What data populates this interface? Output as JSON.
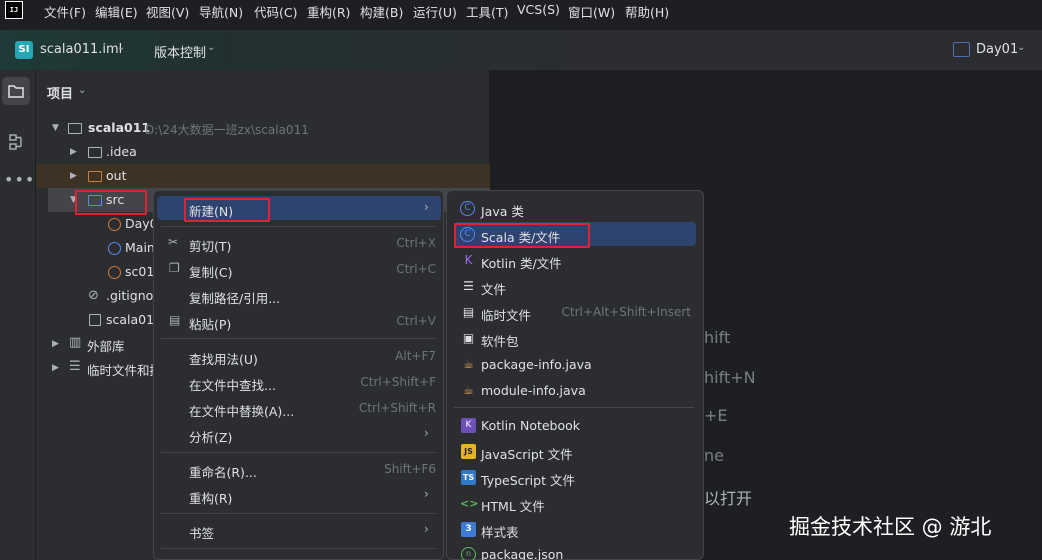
{
  "menubar": {
    "logo": "IJ",
    "items": [
      "文件(F)",
      "编辑(E)",
      "视图(V)",
      "导航(N)",
      "代码(C)",
      "重构(R)",
      "构建(B)",
      "运行(U)",
      "工具(T)",
      "VCS(S)",
      "窗口(W)",
      "帮助(H)"
    ]
  },
  "toolbar": {
    "project_badge": "SI",
    "project_name": "scala011.iml",
    "vcs_label": "版本控制",
    "run_config": "Day01"
  },
  "project_panel": {
    "title": "项目",
    "rows": [
      {
        "label": "scala011",
        "hint": "D:\\24大数据一班zx\\scala011"
      },
      {
        "label": ".idea"
      },
      {
        "label": "out"
      },
      {
        "label": "src"
      },
      {
        "label": "Day0"
      },
      {
        "label": "Main"
      },
      {
        "label": "sc01"
      },
      {
        "label": ".gitignor"
      },
      {
        "label": "scala011"
      },
      {
        "label": "外部库"
      },
      {
        "label": "临时文件和控"
      }
    ]
  },
  "editor": {
    "hints": [
      "hift",
      "hift+N",
      "+E",
      "ne",
      "以打开"
    ]
  },
  "context_menu": {
    "items": [
      {
        "label": "新建(N)",
        "shortcut": "",
        "submenu": true
      },
      {
        "label": "剪切(T)",
        "shortcut": "Ctrl+X"
      },
      {
        "label": "复制(C)",
        "shortcut": "Ctrl+C"
      },
      {
        "label": "复制路径/引用...",
        "shortcut": ""
      },
      {
        "label": "粘贴(P)",
        "shortcut": "Ctrl+V"
      },
      {
        "label": "查找用法(U)",
        "shortcut": "Alt+F7"
      },
      {
        "label": "在文件中查找...",
        "shortcut": "Ctrl+Shift+F"
      },
      {
        "label": "在文件中替换(A)...",
        "shortcut": "Ctrl+Shift+R"
      },
      {
        "label": "分析(Z)",
        "shortcut": "",
        "submenu": true
      },
      {
        "label": "重命名(R)...",
        "shortcut": "Shift+F6"
      },
      {
        "label": "重构(R)",
        "shortcut": "",
        "submenu": true
      },
      {
        "label": "书签",
        "shortcut": "",
        "submenu": true
      }
    ]
  },
  "new_submenu": {
    "items": [
      {
        "label": "Java 类",
        "icon": "java-class-icon",
        "shortcut": ""
      },
      {
        "label": "Scala 类/文件",
        "icon": "scala-class-icon",
        "shortcut": ""
      },
      {
        "label": "Kotlin 类/文件",
        "icon": "kotlin-icon",
        "shortcut": ""
      },
      {
        "label": "文件",
        "icon": "file-icon",
        "shortcut": ""
      },
      {
        "label": "临时文件",
        "icon": "scratch-file-icon",
        "shortcut": "Ctrl+Alt+Shift+Insert"
      },
      {
        "label": "软件包",
        "icon": "package-icon",
        "shortcut": ""
      },
      {
        "label": "package-info.java",
        "icon": "coffee-icon",
        "shortcut": ""
      },
      {
        "label": "module-info.java",
        "icon": "coffee-icon",
        "shortcut": ""
      },
      {
        "label": "Kotlin Notebook",
        "icon": "notebook-icon",
        "shortcut": ""
      },
      {
        "label": "JavaScript 文件",
        "icon": "js-icon",
        "shortcut": ""
      },
      {
        "label": "TypeScript 文件",
        "icon": "ts-icon",
        "shortcut": ""
      },
      {
        "label": "HTML 文件",
        "icon": "html-icon",
        "shortcut": ""
      },
      {
        "label": "样式表",
        "icon": "css-icon",
        "shortcut": ""
      },
      {
        "label": "package.json",
        "icon": "json-icon",
        "shortcut": ""
      }
    ]
  },
  "watermark": "掘金技术社区 @ 游北",
  "colors": {
    "selection": "#2e436e",
    "highlight_box": "#e0242f",
    "panel_bg": "#2b2d30",
    "editor_bg": "#1e1f22"
  }
}
